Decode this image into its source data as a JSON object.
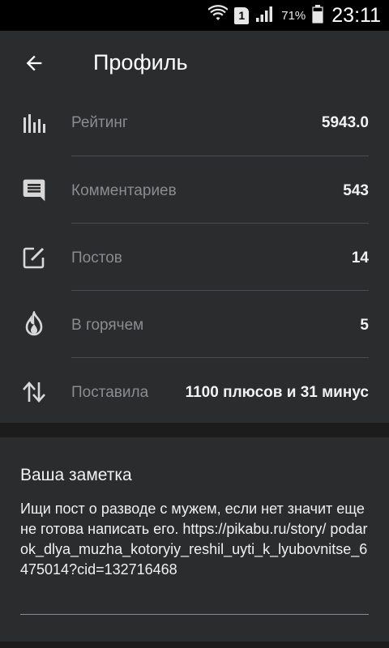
{
  "status_bar": {
    "sim_slot": "1",
    "battery_percent": "71%",
    "time": "23:11"
  },
  "app_bar": {
    "title": "Профиль",
    "back_icon": "arrow-left-icon"
  },
  "stats": [
    {
      "icon": "bar-chart-icon",
      "label": "Рейтинг",
      "value": "5943.0"
    },
    {
      "icon": "comment-icon",
      "label": "Комментариев",
      "value": "543"
    },
    {
      "icon": "edit-square-icon",
      "label": "Постов",
      "value": "14"
    },
    {
      "icon": "flame-icon",
      "label": "В горячем",
      "value": "5"
    },
    {
      "icon": "up-down-arrows-icon",
      "label": "Поставила",
      "value": "1100 плюсов и 31 минус"
    }
  ],
  "note": {
    "title": "Ваша заметка",
    "text": "Ищи пост о разводе с мужем, если нет значит еще не готова написать его. https://pikabu.ru/story/ podarok_dlya_muzha_kotoryiy_reshil_uyti_k_lyubovnitse_6475014?cid=132716468"
  },
  "colors": {
    "background": "#1c1c1c",
    "card": "#2a2c2d",
    "label": "#8a8d8f",
    "value": "#f2f2f2"
  }
}
